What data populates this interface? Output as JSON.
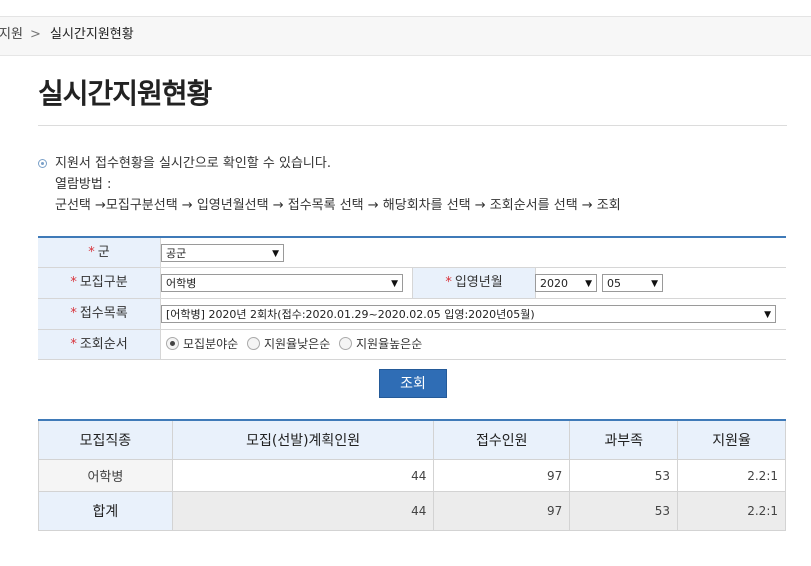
{
  "breadcrumb": {
    "prev": "지원",
    "separator": ">",
    "current": "실시간지원현황"
  },
  "page_title": "실시간지원현황",
  "info": {
    "line1": "지원서 접수현황을 실시간으로 확인할 수 있습니다.",
    "line2": "열람방법 :",
    "line3": "군선택 →모집구분선택 → 입영년월선택 → 접수목록 선택 → 해당회차를 선택 → 조회순서를 선택 → 조회"
  },
  "form": {
    "required_mark": "*",
    "army_label": "군",
    "army_value": "공군",
    "category_label": "모집구분",
    "category_value": "어학병",
    "enlist_label": "입영년월",
    "year_value": "2020",
    "month_value": "05",
    "receipt_label": "접수목록",
    "receipt_value": "[어학병] 2020년 2회차(접수:2020.01.29~2020.02.05 입영:2020년05월)",
    "order_label": "조회순서",
    "order_options": [
      "모집분야순",
      "지원율낮은순",
      "지원율높은순"
    ],
    "order_selected": 0,
    "arrow": "▼"
  },
  "search_button": "조회",
  "table": {
    "headers": [
      "모집직종",
      "모집(선발)계획인원",
      "접수인원",
      "과부족",
      "지원율"
    ],
    "rows": [
      {
        "name": "어학병",
        "plan": "44",
        "applied": "97",
        "diff": "53",
        "rate": "2.2:1"
      }
    ],
    "total": {
      "name": "합계",
      "plan": "44",
      "applied": "97",
      "diff": "53",
      "rate": "2.2:1"
    }
  }
}
